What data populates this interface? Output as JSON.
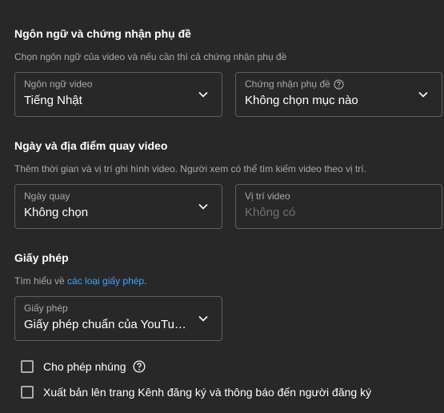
{
  "language_section": {
    "title": "Ngôn ngữ và chứng nhận phụ đề",
    "description": "Chọn ngôn ngữ của video và nếu cần thì cả chứng nhận phụ đề",
    "video_language": {
      "label": "Ngôn ngữ video",
      "value": "Tiếng Nhật"
    },
    "caption_cert": {
      "label": "Chứng nhận phụ đề",
      "value": "Không chọn mục nào"
    }
  },
  "date_location_section": {
    "title": "Ngày và địa điểm quay video",
    "description": "Thêm thời gian và vị trí ghi hình video. Người xem có thể tìm kiếm video theo vị trí.",
    "recording_date": {
      "label": "Ngày quay",
      "value": "Không chọn"
    },
    "video_location": {
      "label": "Vị trí video",
      "placeholder": "Không có"
    }
  },
  "license_section": {
    "title": "Giấy phép",
    "learn_prefix": "Tìm hiểu về ",
    "learn_link": "các loại giấy phép",
    "learn_suffix": ".",
    "license": {
      "label": "Giấy phép",
      "value": "Giấy phép chuẩn của YouTu…"
    }
  },
  "options": {
    "allow_embedding": {
      "label": "Cho phép nhúng",
      "checked": false
    },
    "publish_to_feed": {
      "label": "Xuất bản lên trang Kênh đăng ký và thông báo đến người đăng ký",
      "checked": false
    }
  },
  "icons": {
    "chevron": "chevron-down-icon",
    "help": "help-circle-icon"
  }
}
